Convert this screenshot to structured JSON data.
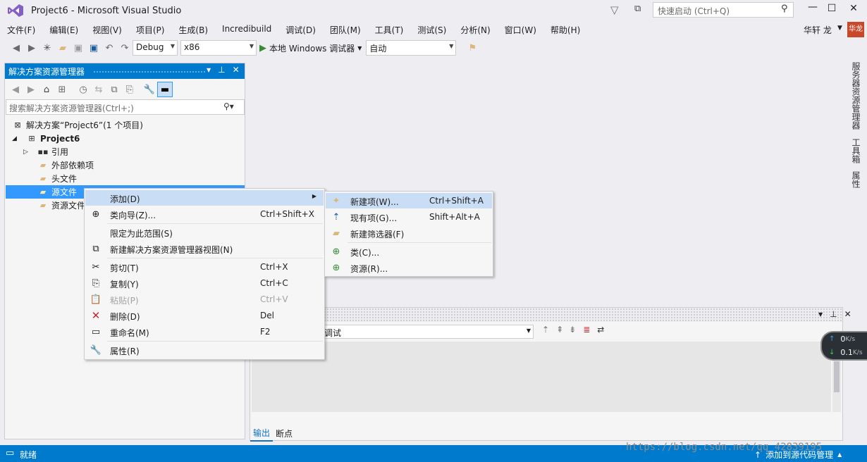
{
  "window": {
    "title": "Project6 - Microsoft Visual Studio",
    "quick_launch_placeholder": "快速启动 (Ctrl+Q)"
  },
  "menubar": [
    "文件(F)",
    "编辑(E)",
    "视图(V)",
    "项目(P)",
    "生成(B)",
    "Incredibuild",
    "调试(D)",
    "团队(M)",
    "工具(T)",
    "测试(S)",
    "分析(N)",
    "窗口(W)",
    "帮助(H)"
  ],
  "user": {
    "name": "华轩 龙",
    "avatar_text": "华龙"
  },
  "toolbar": {
    "config": "Debug",
    "platform": "x86",
    "run_label": "本地 Windows 调试器",
    "mode": "自动"
  },
  "solution_explorer": {
    "title": "解决方案资源管理器",
    "search_placeholder": "搜索解决方案资源管理器(Ctrl+;)",
    "tree": [
      {
        "label": "解决方案“Project6”(1 个项目)"
      },
      {
        "label": "Project6"
      },
      {
        "label": "引用"
      },
      {
        "label": "外部依赖项"
      },
      {
        "label": "头文件"
      },
      {
        "label": "源文件"
      },
      {
        "label": "资源文件"
      }
    ]
  },
  "side_tabs": [
    "服务器资源管理器",
    "工具箱",
    "属性"
  ],
  "context_menu": [
    {
      "label": "添加(D)",
      "shortcut": "",
      "icon": "none",
      "submenu": true
    },
    {
      "label": "类向导(Z)...",
      "shortcut": "Ctrl+Shift+X",
      "icon": "class-wizard-icon"
    },
    {
      "label": "限定为此范围(S)",
      "shortcut": "",
      "icon": "none"
    },
    {
      "label": "新建解决方案资源管理器视图(N)",
      "shortcut": "",
      "icon": "new-view-icon"
    },
    {
      "label": "剪切(T)",
      "shortcut": "Ctrl+X",
      "icon": "cut-icon"
    },
    {
      "label": "复制(Y)",
      "shortcut": "Ctrl+C",
      "icon": "copy-icon"
    },
    {
      "label": "粘贴(P)",
      "shortcut": "Ctrl+V",
      "icon": "paste-icon",
      "disabled": true
    },
    {
      "label": "删除(D)",
      "shortcut": "Del",
      "icon": "delete-icon"
    },
    {
      "label": "重命名(M)",
      "shortcut": "F2",
      "icon": "rename-icon"
    },
    {
      "label": "属性(R)",
      "shortcut": "",
      "icon": "wrench-icon"
    }
  ],
  "submenu": [
    {
      "label": "新建项(W)...",
      "shortcut": "Ctrl+Shift+A"
    },
    {
      "label": "现有项(G)...",
      "shortcut": "Shift+Alt+A"
    },
    {
      "label": "新建筛选器(F)",
      "shortcut": ""
    },
    {
      "label": "类(C)...",
      "shortcut": ""
    },
    {
      "label": "资源(R)...",
      "shortcut": ""
    }
  ],
  "output": {
    "source": "调试",
    "tabs": [
      "输出",
      "断点"
    ]
  },
  "network": {
    "up": "0",
    "up_unit": "K/s",
    "down": "0.1",
    "down_unit": "K/s"
  },
  "status": {
    "text": "就绪",
    "source_control": "添加到源代码管理"
  },
  "watermark": "https://blog.csdn.net/qq_42839195",
  "colors": {
    "accent": "#007acc",
    "selection": "#3399ff",
    "menu_highlight": "#c9def5"
  }
}
